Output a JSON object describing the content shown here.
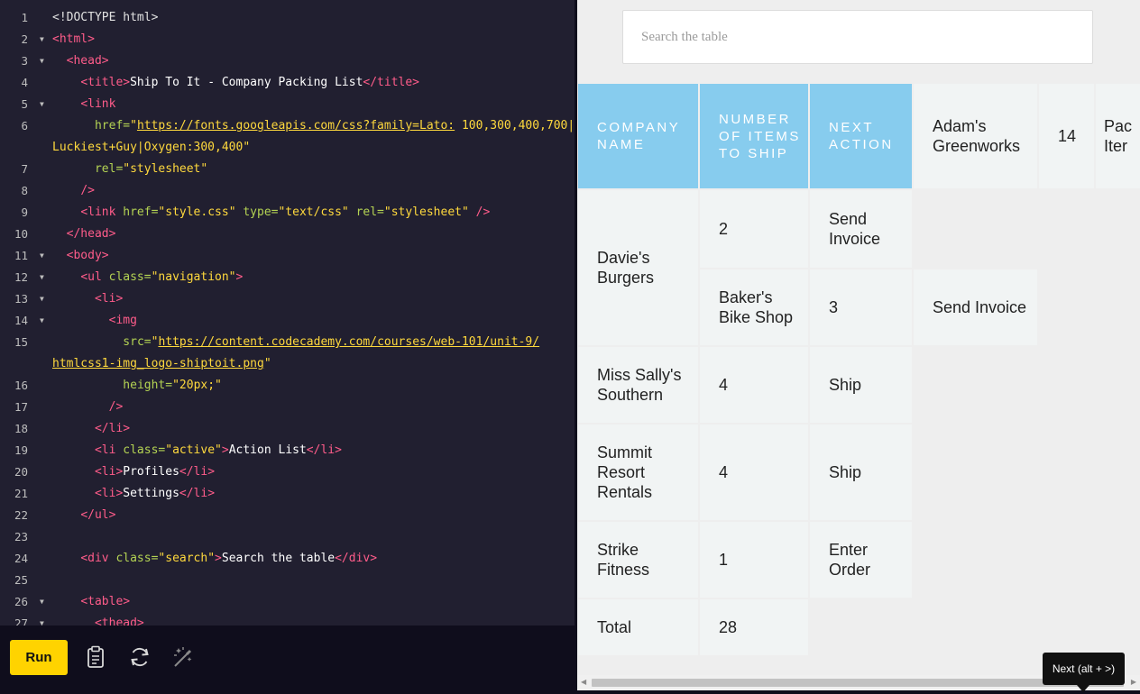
{
  "editor": {
    "lines": [
      {
        "n": "1",
        "fold": false,
        "indent": 0,
        "parts": [
          {
            "t": "<!DOCTYPE html>",
            "c": "c-dim"
          }
        ]
      },
      {
        "n": "2",
        "fold": true,
        "indent": 0,
        "parts": [
          {
            "t": "<html>",
            "c": "c-tag"
          }
        ]
      },
      {
        "n": "3",
        "fold": true,
        "indent": 2,
        "parts": [
          {
            "t": "<head>",
            "c": "c-tag"
          }
        ]
      },
      {
        "n": "4",
        "fold": false,
        "indent": 4,
        "parts": [
          {
            "t": "<title>",
            "c": "c-tag"
          },
          {
            "t": "Ship To It - Company Packing List",
            "c": "c-text"
          },
          {
            "t": "</title>",
            "c": "c-tag"
          }
        ]
      },
      {
        "n": "5",
        "fold": true,
        "indent": 4,
        "parts": [
          {
            "t": "<link",
            "c": "c-tag"
          }
        ]
      },
      {
        "n": "6",
        "fold": false,
        "indent": 6,
        "parts": [
          {
            "t": "href=",
            "c": "c-attr"
          },
          {
            "t": "\"",
            "c": "c-str"
          },
          {
            "t": "https://fonts.googleapis.com/css?family=Lato:",
            "c": "c-link"
          },
          {
            "t": " 100,300,400,700|",
            "c": "c-str"
          }
        ]
      },
      {
        "n": "",
        "fold": false,
        "indent": 0,
        "parts": [
          {
            "t": "Luckiest+Guy|Oxygen:300,400\"",
            "c": "c-str"
          }
        ]
      },
      {
        "n": "7",
        "fold": false,
        "indent": 6,
        "parts": [
          {
            "t": "rel=",
            "c": "c-attr"
          },
          {
            "t": "\"stylesheet\"",
            "c": "c-str"
          }
        ]
      },
      {
        "n": "8",
        "fold": false,
        "indent": 4,
        "parts": [
          {
            "t": "/>",
            "c": "c-tag"
          }
        ]
      },
      {
        "n": "9",
        "fold": false,
        "indent": 4,
        "parts": [
          {
            "t": "<link ",
            "c": "c-tag"
          },
          {
            "t": "href=",
            "c": "c-attr"
          },
          {
            "t": "\"style.css\" ",
            "c": "c-str"
          },
          {
            "t": "type=",
            "c": "c-attr"
          },
          {
            "t": "\"text/css\" ",
            "c": "c-str"
          },
          {
            "t": "rel=",
            "c": "c-attr"
          },
          {
            "t": "\"stylesheet\" ",
            "c": "c-str"
          },
          {
            "t": "/>",
            "c": "c-tag"
          }
        ]
      },
      {
        "n": "10",
        "fold": false,
        "indent": 2,
        "parts": [
          {
            "t": "</head>",
            "c": "c-tag"
          }
        ]
      },
      {
        "n": "11",
        "fold": true,
        "indent": 2,
        "parts": [
          {
            "t": "<body>",
            "c": "c-tag"
          }
        ]
      },
      {
        "n": "12",
        "fold": true,
        "indent": 4,
        "parts": [
          {
            "t": "<ul ",
            "c": "c-tag"
          },
          {
            "t": "class=",
            "c": "c-attr"
          },
          {
            "t": "\"navigation\"",
            "c": "c-str"
          },
          {
            "t": ">",
            "c": "c-tag"
          }
        ]
      },
      {
        "n": "13",
        "fold": true,
        "indent": 6,
        "parts": [
          {
            "t": "<li>",
            "c": "c-tag"
          }
        ]
      },
      {
        "n": "14",
        "fold": true,
        "indent": 8,
        "parts": [
          {
            "t": "<img",
            "c": "c-tag"
          }
        ]
      },
      {
        "n": "15",
        "fold": false,
        "indent": 10,
        "parts": [
          {
            "t": "src=",
            "c": "c-attr"
          },
          {
            "t": "\"",
            "c": "c-str"
          },
          {
            "t": "https://content.codecademy.com/courses/web-101/unit-9/",
            "c": "c-link"
          }
        ]
      },
      {
        "n": "",
        "fold": false,
        "indent": 0,
        "parts": [
          {
            "t": "htmlcss1-img_logo-shiptoit.png",
            "c": "c-link"
          },
          {
            "t": "\"",
            "c": "c-str"
          }
        ]
      },
      {
        "n": "16",
        "fold": false,
        "indent": 10,
        "parts": [
          {
            "t": "height=",
            "c": "c-attr"
          },
          {
            "t": "\"20px;\"",
            "c": "c-str"
          }
        ]
      },
      {
        "n": "17",
        "fold": false,
        "indent": 8,
        "parts": [
          {
            "t": "/>",
            "c": "c-tag"
          }
        ]
      },
      {
        "n": "18",
        "fold": false,
        "indent": 6,
        "parts": [
          {
            "t": "</li>",
            "c": "c-tag"
          }
        ]
      },
      {
        "n": "19",
        "fold": false,
        "indent": 6,
        "parts": [
          {
            "t": "<li ",
            "c": "c-tag"
          },
          {
            "t": "class=",
            "c": "c-attr"
          },
          {
            "t": "\"active\"",
            "c": "c-str"
          },
          {
            "t": ">",
            "c": "c-tag"
          },
          {
            "t": "Action List",
            "c": "c-text"
          },
          {
            "t": "</li>",
            "c": "c-tag"
          }
        ]
      },
      {
        "n": "20",
        "fold": false,
        "indent": 6,
        "parts": [
          {
            "t": "<li>",
            "c": "c-tag"
          },
          {
            "t": "Profiles",
            "c": "c-text"
          },
          {
            "t": "</li>",
            "c": "c-tag"
          }
        ]
      },
      {
        "n": "21",
        "fold": false,
        "indent": 6,
        "parts": [
          {
            "t": "<li>",
            "c": "c-tag"
          },
          {
            "t": "Settings",
            "c": "c-text"
          },
          {
            "t": "</li>",
            "c": "c-tag"
          }
        ]
      },
      {
        "n": "22",
        "fold": false,
        "indent": 4,
        "parts": [
          {
            "t": "</ul>",
            "c": "c-tag"
          }
        ]
      },
      {
        "n": "23",
        "fold": false,
        "indent": 0,
        "parts": []
      },
      {
        "n": "24",
        "fold": false,
        "indent": 4,
        "parts": [
          {
            "t": "<div ",
            "c": "c-tag"
          },
          {
            "t": "class=",
            "c": "c-attr"
          },
          {
            "t": "\"search\"",
            "c": "c-str"
          },
          {
            "t": ">",
            "c": "c-tag"
          },
          {
            "t": "Search the table",
            "c": "c-text"
          },
          {
            "t": "</div>",
            "c": "c-tag"
          }
        ]
      },
      {
        "n": "25",
        "fold": false,
        "indent": 0,
        "parts": []
      },
      {
        "n": "26",
        "fold": true,
        "indent": 4,
        "parts": [
          {
            "t": "<table>",
            "c": "c-tag"
          }
        ]
      },
      {
        "n": "27",
        "fold": true,
        "indent": 6,
        "parts": [
          {
            "t": "<thead>",
            "c": "c-tag"
          }
        ]
      }
    ]
  },
  "toolbar": {
    "run_label": "Run",
    "icons": [
      "clipboard-icon",
      "refresh-icon",
      "magic-wand-icon"
    ]
  },
  "preview": {
    "search_placeholder": "Search the table",
    "table": {
      "headers": [
        "Company Name",
        "Number of items to ship",
        "Next action"
      ],
      "header_row_extra": [
        "Adam's Greenworks",
        "14",
        "Pac\nIter"
      ],
      "rows": [
        [
          "Davie's Burgers",
          "2",
          "Send Invoice"
        ],
        [
          "Baker's Bike Shop",
          "3",
          "Send Invoice"
        ],
        [
          "Miss Sally's Southern",
          "4",
          "Ship"
        ],
        [
          "Summit Resort Rentals",
          "4",
          "Ship"
        ],
        [
          "Strike Fitness",
          "1",
          "Enter Order"
        ],
        [
          "Total",
          "28"
        ]
      ]
    }
  },
  "tooltip": {
    "label": "Next (alt + >)"
  },
  "colors": {
    "editor_bg": "#211f30",
    "toolbar_bg": "#0f0d1c",
    "run_button": "#ffd300",
    "table_header": "#87ccee",
    "table_cell": "#f1f4f4",
    "tag": "#ff5c8a",
    "attr": "#b4d353",
    "string": "#ffd93d"
  }
}
